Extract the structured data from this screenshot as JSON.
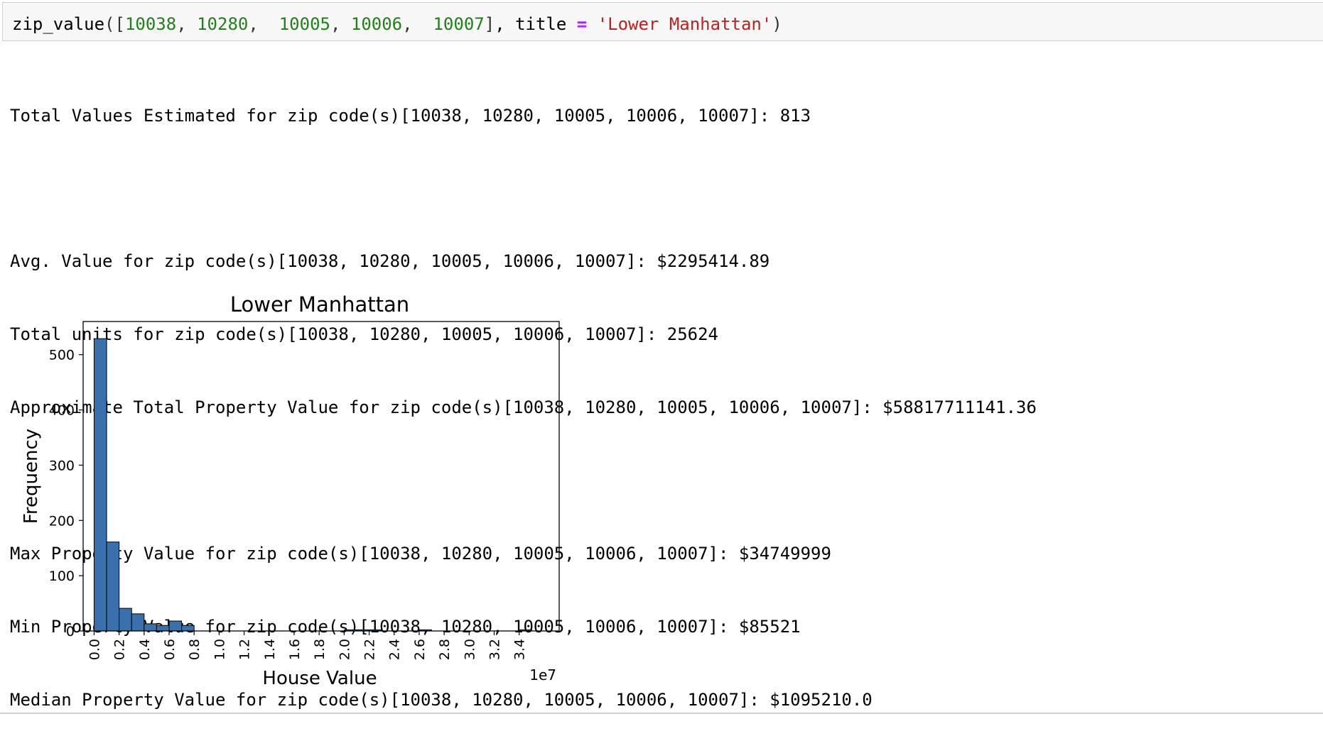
{
  "input": {
    "tokens": [
      {
        "text": "zip_value",
        "cls": "t-plain"
      },
      {
        "text": "(",
        "cls": "t-punct"
      },
      {
        "text": "[",
        "cls": "t-punct"
      },
      {
        "text": "10038",
        "cls": "t-num"
      },
      {
        "text": ", ",
        "cls": "t-punct"
      },
      {
        "text": "10280",
        "cls": "t-num"
      },
      {
        "text": ",  ",
        "cls": "t-punct"
      },
      {
        "text": "10005",
        "cls": "t-num"
      },
      {
        "text": ", ",
        "cls": "t-punct"
      },
      {
        "text": "10006",
        "cls": "t-num"
      },
      {
        "text": ",  ",
        "cls": "t-punct"
      },
      {
        "text": "10007",
        "cls": "t-num"
      },
      {
        "text": "]",
        "cls": "t-punct"
      },
      {
        "text": ", title ",
        "cls": "t-plain"
      },
      {
        "text": "=",
        "cls": "t-op"
      },
      {
        "text": " ",
        "cls": "t-plain"
      },
      {
        "text": "'Lower Manhattan'",
        "cls": "t-str"
      },
      {
        "text": ")",
        "cls": "t-punct"
      }
    ]
  },
  "output": {
    "total_values": "Total Values Estimated for zip code(s)[10038, 10280, 10005, 10006, 10007]: 813",
    "avg_value": "Avg. Value for zip code(s)[10038, 10280, 10005, 10006, 10007]: $2295414.89",
    "total_units": "Total units for zip code(s)[10038, 10280, 10005, 10006, 10007]: 25624",
    "approx_total": "Approximate Total Property Value for zip code(s)[10038, 10280, 10005, 10006, 10007]: $58817711141.36",
    "max_value": "Max Property Value for zip code(s)[10038, 10280, 10005, 10006, 10007]: $34749999",
    "min_value": "Min Property Value for zip code(s)[10038, 10280, 10005, 10006, 10007]: $85521",
    "median_value": "Median Property Value for zip code(s)[10038, 10280, 10005, 10006, 10007]: $1095210.0"
  },
  "chart_data": {
    "type": "bar",
    "title": "Lower Manhattan",
    "xlabel": "House Value",
    "ylabel": "Frequency",
    "x_offset_label": "1e7",
    "bar_color": "#3a71ad",
    "edge_color": "#000000",
    "bin_edges": [
      0.0,
      0.1,
      0.2,
      0.3,
      0.4,
      0.5,
      0.6,
      0.7,
      0.8,
      0.9,
      1.0,
      1.1,
      1.2,
      1.3,
      1.4,
      1.5,
      1.6,
      1.7,
      1.8,
      1.9,
      2.0,
      2.1,
      2.2,
      2.3,
      2.4,
      2.5,
      2.6,
      2.7,
      2.8,
      2.9,
      3.0,
      3.1,
      3.2,
      3.3,
      3.4,
      3.5
    ],
    "values": [
      529,
      161,
      41,
      31,
      13,
      10,
      18,
      10,
      0,
      0,
      0,
      0,
      0,
      0,
      0,
      0,
      0,
      0,
      0,
      0,
      2,
      2,
      2,
      0,
      0,
      0,
      2,
      0,
      0,
      0,
      0,
      0,
      0,
      0,
      2
    ],
    "xlim": [
      -0.0878,
      2.0
    ],
    "ylim": [
      0,
      560
    ],
    "x_ticks": [
      "0.0",
      "0.2",
      "0.4",
      "0.6",
      "0.8",
      "1.0",
      "1.2",
      "1.4",
      "1.6",
      "1.8",
      "2.0",
      "2.2",
      "2.4",
      "2.6",
      "2.8",
      "3.0",
      "3.2",
      "3.4"
    ],
    "y_ticks": [
      "0",
      "100",
      "200",
      "300",
      "400",
      "500"
    ],
    "grid": false
  }
}
